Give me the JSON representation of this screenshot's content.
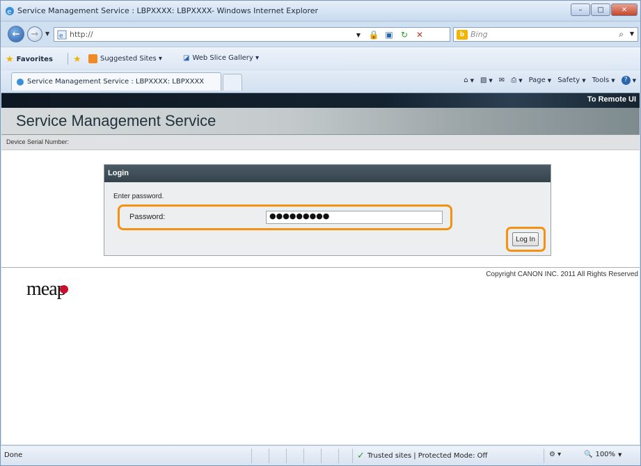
{
  "window": {
    "title": "Service Management Service : LBPXXXX: LBPXXXX- Windows Internet Explorer",
    "controls": {
      "minimize": "–",
      "maximize": "□",
      "close": "✕"
    }
  },
  "address_bar": {
    "url": "http://",
    "search_placeholder": "Bing"
  },
  "favorites_bar": {
    "favorites_label": "Favorites",
    "items": [
      "Suggested Sites ▾",
      "Web Slice Gallery ▾"
    ]
  },
  "tab": {
    "title": "Service Management Service : LBPXXXX: LBPXXXX"
  },
  "command_bar": {
    "page": "Page",
    "safety": "Safety",
    "tools": "Tools"
  },
  "page": {
    "remote_ui_link": "To Remote UI",
    "service_title": "Service Management Service",
    "serial_label": "Device Serial Number:",
    "login": {
      "heading": "Login",
      "instruction": "Enter password.",
      "password_label": "Password:",
      "password_value": "●●●●●●●●●",
      "button_label": "Log In"
    },
    "copyright": "Copyright CANON INC. 2011 All Rights Reserved",
    "logo_text": "meap"
  },
  "status_bar": {
    "status": "Done",
    "zone": "Trusted sites | Protected Mode: Off",
    "zoom": "100%"
  },
  "colors": {
    "highlight": "#f39212",
    "header_dark": "#35434c",
    "brand_red": "#c8102e"
  }
}
